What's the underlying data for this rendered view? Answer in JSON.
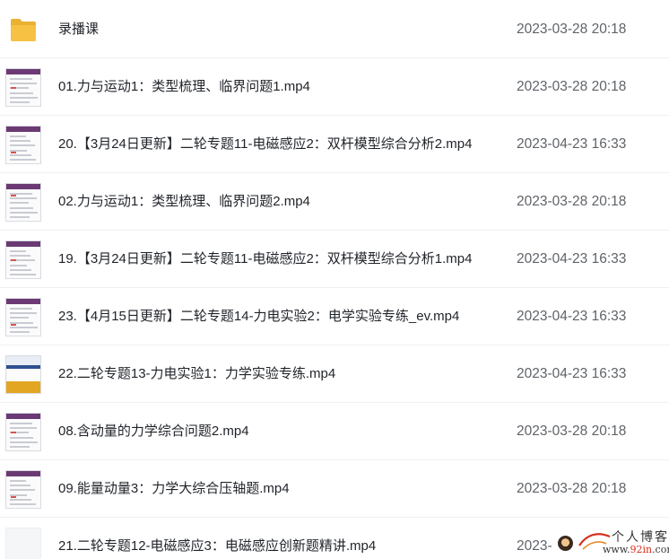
{
  "files": [
    {
      "type": "folder",
      "icon": "folder-icon",
      "name": "录播课",
      "modified": "2023-03-28 20:18"
    },
    {
      "type": "video",
      "icon": "video-thumbnail",
      "name": "01.力与运动1：类型梳理、临界问题1.mp4",
      "modified": "2023-03-28 20:18"
    },
    {
      "type": "video",
      "icon": "video-thumbnail",
      "name": "20.【3月24日更新】二轮专题11-电磁感应2：双杆模型综合分析2.mp4",
      "modified": "2023-04-23 16:33"
    },
    {
      "type": "video",
      "icon": "video-thumbnail",
      "name": "02.力与运动1：类型梳理、临界问题2.mp4",
      "modified": "2023-03-28 20:18"
    },
    {
      "type": "video",
      "icon": "video-thumbnail",
      "name": "19.【3月24日更新】二轮专题11-电磁感应2：双杆模型综合分析1.mp4",
      "modified": "2023-04-23 16:33"
    },
    {
      "type": "video",
      "icon": "video-thumbnail",
      "name": "23.【4月15日更新】二轮专题14-力电实验2：电学实验专练_ev.mp4",
      "modified": "2023-04-23 16:33"
    },
    {
      "type": "video",
      "icon": "video-thumbnail",
      "name": "22.二轮专题13-力电实验1：力学实验专练.mp4",
      "modified": "2023-04-23 16:33"
    },
    {
      "type": "video",
      "icon": "video-thumbnail",
      "name": "08.含动量的力学综合问题2.mp4",
      "modified": "2023-03-28 20:18"
    },
    {
      "type": "video",
      "icon": "video-thumbnail",
      "name": "09.能量动量3：力学大综合压轴题.mp4",
      "modified": "2023-03-28 20:18"
    },
    {
      "type": "video",
      "icon": "video-thumbnail",
      "name": "21.二轮专题12-电磁感应3：电磁感应创新题精讲.mp4",
      "modified": "2023-"
    }
  ],
  "watermark": {
    "title": "个人博客",
    "url_prefix": "www.",
    "url_highlight": "92in",
    "url_suffix": ".com"
  },
  "colors": {
    "thumb_header": "#6b3a74",
    "folder": "#f7c144",
    "text": "#1f2329",
    "timestamp": "#5f6368"
  }
}
